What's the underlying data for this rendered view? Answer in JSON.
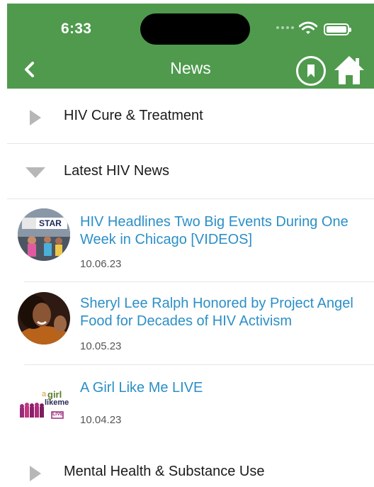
{
  "status_bar": {
    "time": "6:33"
  },
  "header": {
    "title": "News"
  },
  "sections": [
    {
      "label": "HIV Cure & Treatment",
      "expanded": false
    },
    {
      "label": "Latest HIV News",
      "expanded": true
    },
    {
      "label": "Mental Health & Substance Use",
      "expanded": false
    }
  ],
  "news": [
    {
      "headline": "HIV Headlines Two Big Events During One Week in Chicago [VIDEOS]",
      "date": "10.06.23",
      "thumb_text": "STAR"
    },
    {
      "headline": "Sheryl Lee Ralph Honored by Project Angel Food for Decades of HIV Activism",
      "date": "10.05.23"
    },
    {
      "headline": "A Girl Like Me LIVE",
      "date": "10.04.23",
      "thumb_text": {
        "a": "a",
        "girl": "girl",
        "likeme": "likeme",
        "live": "LIVE"
      }
    }
  ],
  "colors": {
    "header_green": "#4f9a4d",
    "link_blue": "#2b8fc7",
    "arrow_gray": "#b7b7b7"
  },
  "icons": [
    "back-chevron-icon",
    "bookmark-icon",
    "home-icon",
    "wifi-icon",
    "battery-icon",
    "expand-arrow-icon",
    "collapse-arrow-icon"
  ]
}
